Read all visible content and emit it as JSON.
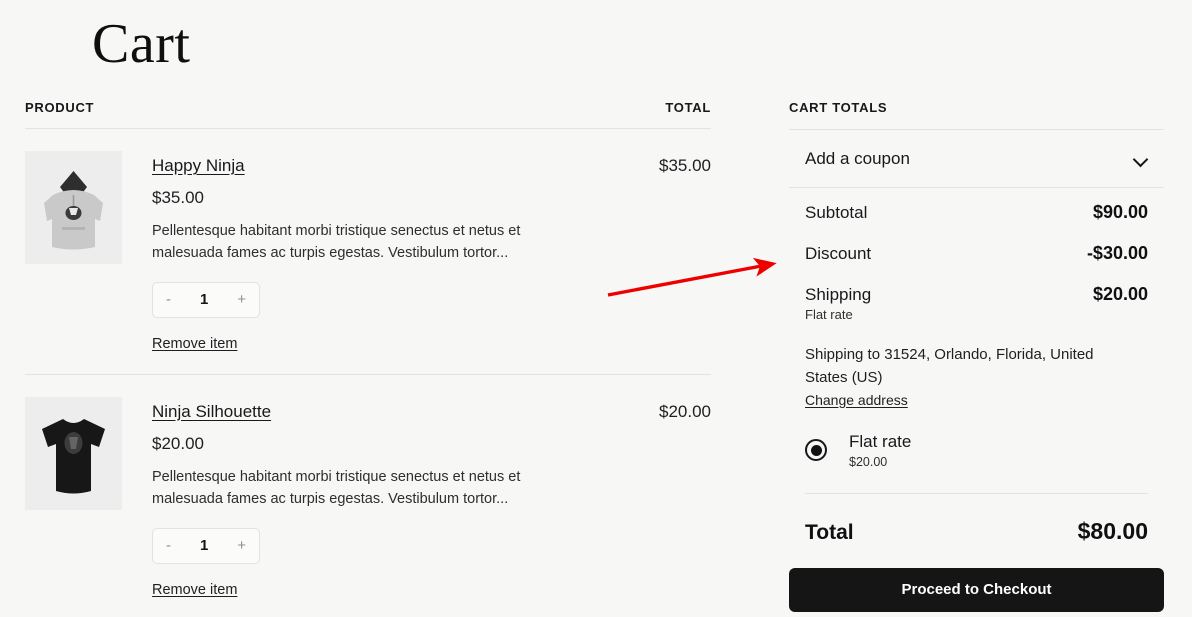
{
  "page": {
    "title": "Cart",
    "accent_color": "#ee0000",
    "background_color": "#f7f7f6",
    "button_color": "#151515"
  },
  "cart_table": {
    "header": {
      "product_label": "PRODUCT",
      "total_label": "TOTAL"
    },
    "items": [
      {
        "name": "Happy Ninja",
        "price": "$35.00",
        "description": "Pellentesque habitant morbi tristique senectus et netus et malesuada fames ac turpis egestas. Vestibulum tortor...",
        "quantity": "1",
        "decrement_label": "-",
        "increment_label": "+",
        "remove_label": "Remove item",
        "line_total": "$35.00",
        "image": "grey-hoodie-thumbnail"
      },
      {
        "name": "Ninja Silhouette",
        "price": "$20.00",
        "description": "Pellentesque habitant morbi tristique senectus et netus et malesuada fames ac turpis egestas. Vestibulum tortor...",
        "quantity": "1",
        "decrement_label": "-",
        "increment_label": "+",
        "remove_label": "Remove item",
        "line_total": "$20.00",
        "image": "black-tshirt-thumbnail"
      }
    ]
  },
  "cart_totals": {
    "heading": "CART TOTALS",
    "coupon": {
      "label": "Add a coupon",
      "icon": "chevron-down-icon"
    },
    "subtotal": {
      "label": "Subtotal",
      "value": "$90.00"
    },
    "discount": {
      "label": "Discount",
      "value": "-$30.00"
    },
    "shipping": {
      "label": "Shipping",
      "value": "$20.00",
      "method_note": "Flat rate"
    },
    "shipping_address": "Shipping to 31524, Orlando, Florida, United States (US)",
    "change_address_label": "Change address",
    "shipping_options": [
      {
        "name": "Flat rate",
        "price": "$20.00",
        "selected": true
      }
    ],
    "total": {
      "label": "Total",
      "value": "$80.00"
    },
    "checkout_label": "Proceed to Checkout"
  }
}
